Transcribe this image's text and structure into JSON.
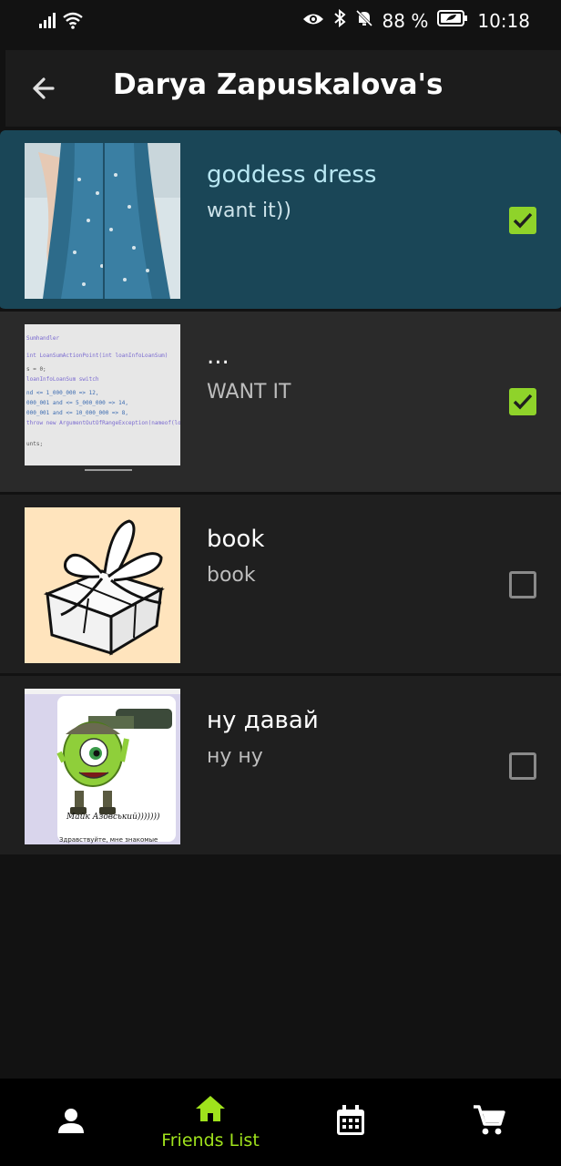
{
  "status_bar": {
    "battery_percent": "88 %",
    "time": "10:18",
    "icons": [
      "signal-icon",
      "wifi-icon",
      "eye-icon",
      "bluetooth-icon",
      "bell-off-icon",
      "battery-icon"
    ]
  },
  "header": {
    "title": "Darya Zapuskalova's",
    "back_icon": "arrow-left-icon"
  },
  "items": [
    {
      "name": "goddess dress",
      "description": "want it))",
      "checked": true,
      "selected": true,
      "image": "blue dress photo"
    },
    {
      "name": "...",
      "description": "WANT IT",
      "checked": true,
      "selected": false,
      "image": "code screenshot"
    },
    {
      "name": "book",
      "description": "book",
      "checked": false,
      "selected": false,
      "image": "gift box drawing"
    },
    {
      "name": "ну давай",
      "description": "ну ну",
      "checked": false,
      "selected": false,
      "image": "cartoon sticker"
    }
  ],
  "thumb_text": {
    "code_lines": [
      "Sumhandler",
      "int LoanSumActionPoint(int loanInfoLoanSum)",
      "s = 0;",
      "loanInfoLoanSum switch",
      "nd <= 1_000_000 => 12,",
      "000_001 and <= 5_000_000 => 14,",
      "000_001 and <= 10_000_000 => 8,",
      "throw new ArgumentOutOfRangeException(nameof(loanInfo",
      "unts;"
    ],
    "sticker_caption": "Майк Азовський)))))))",
    "sticker_footer": "Здравствуйте, мне знакомые"
  },
  "bottom_nav": {
    "items": [
      {
        "icon": "person-icon",
        "label": ""
      },
      {
        "icon": "home-icon",
        "label": "Friends List",
        "active": true
      },
      {
        "icon": "calendar-icon",
        "label": ""
      },
      {
        "icon": "cart-icon",
        "label": ""
      }
    ]
  },
  "colors": {
    "accent": "#9fe21c",
    "selected_row": "#1a4657",
    "background": "#121212",
    "row": "#1f1f1f",
    "checkbox_on": "#8fd32a"
  }
}
